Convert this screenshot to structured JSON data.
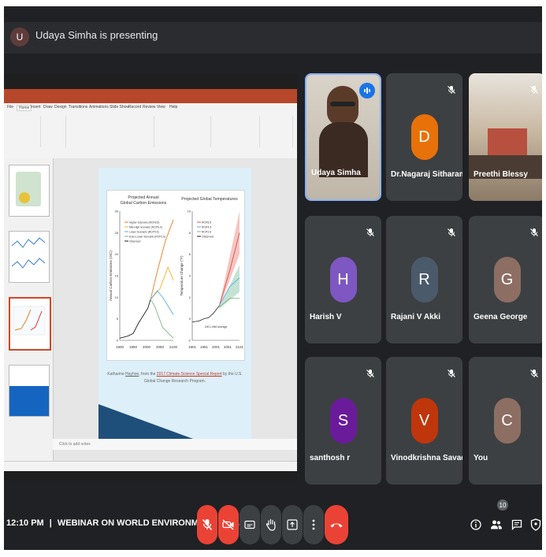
{
  "header": {
    "presenter_initial": "U",
    "presenting_text": "Udaya Simha is presenting"
  },
  "slide": {
    "chart_left": {
      "title": "Projected Annual\nGlobal Carbon Emissions",
      "ylabel": "Annual Carbon Emissions (GtC)",
      "x_ticks": [
        "1900",
        "1950",
        "2000",
        "2050",
        "2100"
      ],
      "y_ticks": [
        "0",
        "5",
        "10",
        "15",
        "20",
        "25",
        "30"
      ],
      "legend": [
        "Higher Scenario (RCP8.5)",
        "Mid-High Scenario (RCP6.0)",
        "Lower Scenario (RCP4.5)",
        "Even Lower Scenario (RCP2.6)",
        "Observed"
      ],
      "series_colors": [
        "#e67e22",
        "#f0b429",
        "#5dade2",
        "#7fb77e",
        "#222222"
      ]
    },
    "chart_right": {
      "title": "Projected Global Temperatures",
      "ylabel": "Temperature Change (°F)",
      "x_ticks": [
        "1901",
        "1951",
        "2001",
        "2051",
        "2101"
      ],
      "y_ticks": [
        "-2",
        "0",
        "2",
        "4",
        "6",
        "8",
        "10"
      ],
      "legend": [
        "RCP8.5",
        "RCP4.5",
        "RCP2.6",
        "Observed"
      ],
      "annotation": "1901-1960 average"
    },
    "caption_pre": "Katharine ",
    "caption_name": "Hayhoe",
    "caption_mid": ", from the ",
    "caption_link": "2017 Climate Science Special Report",
    "caption_post": " by the U.S. Global Change Research Program.",
    "notes_placeholder": "Click to add notes"
  },
  "participants": [
    {
      "name": "Udaya Simha",
      "initial": "",
      "color": "#6b6b6b",
      "muted": false,
      "speaking": true,
      "video": true
    },
    {
      "name": "Dr.Nagaraj Sitharam",
      "initial": "D",
      "color": "#e8710a",
      "muted": true,
      "speaking": false,
      "video": false
    },
    {
      "name": "Preethi Blessy",
      "initial": "",
      "color": "#7a6a55",
      "muted": true,
      "speaking": false,
      "video": true
    },
    {
      "name": "Harish V",
      "initial": "H",
      "color": "#7e57c2",
      "muted": true,
      "speaking": false,
      "video": false
    },
    {
      "name": "Rajani V Akki",
      "initial": "R",
      "color": "#4a5a6a",
      "muted": true,
      "speaking": false,
      "video": false
    },
    {
      "name": "Geena George",
      "initial": "G",
      "color": "#8d6e63",
      "muted": true,
      "speaking": false,
      "video": false
    },
    {
      "name": "santhosh r",
      "initial": "S",
      "color": "#6a1b9a",
      "muted": true,
      "speaking": false,
      "video": false
    },
    {
      "name": "Vinodkrishna Savadi",
      "initial": "V",
      "color": "#bf360c",
      "muted": true,
      "speaking": false,
      "video": false
    },
    {
      "name": "You",
      "initial": "C",
      "color": "#8d6e63",
      "muted": true,
      "speaking": false,
      "video": false
    }
  ],
  "footer": {
    "time": "12:10 PM",
    "separator": "|",
    "meeting_title": "WEBINAR ON WORLD ENVIRONMENT DAY...",
    "participant_count": "10"
  },
  "colors": {
    "end_call": "#ea4335",
    "mic_off": "#ea4335",
    "speaking": "#1a73e8",
    "bg": "#202124"
  }
}
